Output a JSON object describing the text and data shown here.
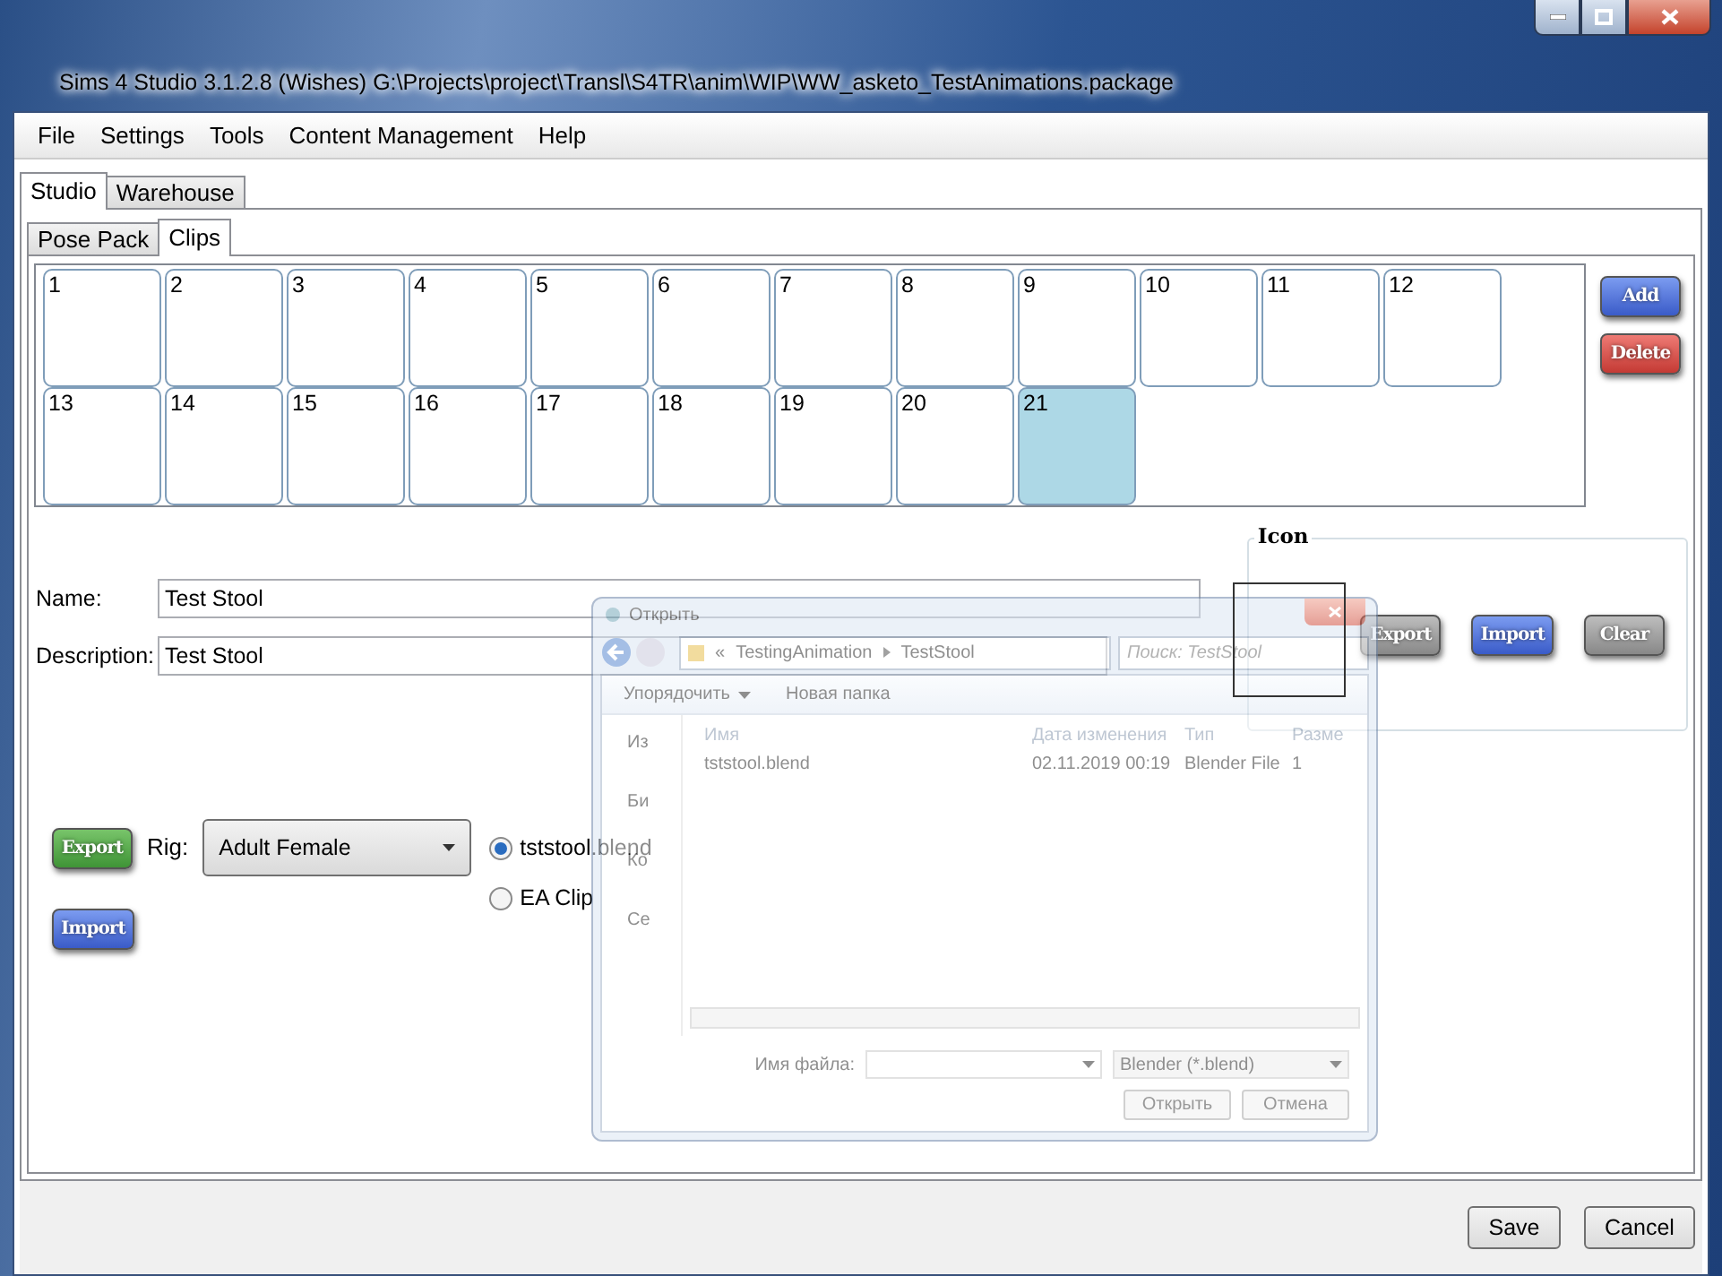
{
  "window": {
    "title": "Sims 4 Studio 3.1.2.8 (Wishes)  G:\\Projects\\project\\Transl\\S4TR\\anim\\WIP\\WW_asketo_TestAnimations.package"
  },
  "menu": [
    "File",
    "Settings",
    "Tools",
    "Content Management",
    "Help"
  ],
  "tabs": [
    {
      "label": "Studio",
      "selected": true
    },
    {
      "label": "Warehouse",
      "selected": false
    }
  ],
  "sub_tabs": [
    {
      "label": "Pose Pack",
      "selected": false
    },
    {
      "label": "Clips",
      "selected": true
    }
  ],
  "clips": [
    {
      "label": "1",
      "selected": false
    },
    {
      "label": "2",
      "selected": false
    },
    {
      "label": "3",
      "selected": false
    },
    {
      "label": "4",
      "selected": false
    },
    {
      "label": "5",
      "selected": false
    },
    {
      "label": "6",
      "selected": false
    },
    {
      "label": "7",
      "selected": false
    },
    {
      "label": "8",
      "selected": false
    },
    {
      "label": "9",
      "selected": false
    },
    {
      "label": "10",
      "selected": false
    },
    {
      "label": "11",
      "selected": false
    },
    {
      "label": "12",
      "selected": false
    },
    {
      "label": "13",
      "selected": false
    },
    {
      "label": "14",
      "selected": false
    },
    {
      "label": "15",
      "selected": false
    },
    {
      "label": "16",
      "selected": false
    },
    {
      "label": "17",
      "selected": false
    },
    {
      "label": "18",
      "selected": false
    },
    {
      "label": "19",
      "selected": false
    },
    {
      "label": "20",
      "selected": false
    },
    {
      "label": "21",
      "selected": true
    }
  ],
  "clip_buttons": [
    {
      "label": "Add",
      "kind": "blue"
    },
    {
      "label": "Delete",
      "kind": "red"
    }
  ],
  "name_field": {
    "label": "Name:",
    "value": "Test Stool"
  },
  "description_field": {
    "label": "Description:",
    "value": "Test Stool"
  },
  "icon_group": {
    "title": "Icon",
    "buttons": [
      {
        "label": "Export",
        "kind": "grey"
      },
      {
        "label": "Import",
        "kind": "blue"
      },
      {
        "label": "Clear",
        "kind": "grey"
      }
    ]
  },
  "export_button": {
    "label": "Export",
    "kind": "green"
  },
  "rig": {
    "label": "Rig:",
    "value": "Adult Female"
  },
  "sources": [
    {
      "label": "tststool.blend",
      "selected": true
    },
    {
      "label": "EA Clip",
      "selected": false
    }
  ],
  "import_button": {
    "label": "Import",
    "kind": "blue"
  },
  "dialog": {
    "title": "Открыть",
    "path_prefix": "«",
    "path": [
      "TestingAnimation",
      "TestStool"
    ],
    "search_placeholder": "Поиск: TestStool",
    "toolbar": [
      "Упорядочить",
      "Новая папка"
    ],
    "nav": [
      "Из",
      "Би",
      "Ко",
      "Се"
    ],
    "columns": [
      "Имя",
      "Дата изменения",
      "Тип",
      "Разме"
    ],
    "files": [
      {
        "name": "tststool.blend",
        "date": "02.11.2019 00:19",
        "type": "Blender File",
        "size": "1"
      }
    ],
    "filename_label": "Имя файла:",
    "filter": "Blender (*.blend)",
    "buttons": [
      "Открыть",
      "Отмена"
    ]
  },
  "footer_buttons": [
    "Save",
    "Cancel"
  ]
}
